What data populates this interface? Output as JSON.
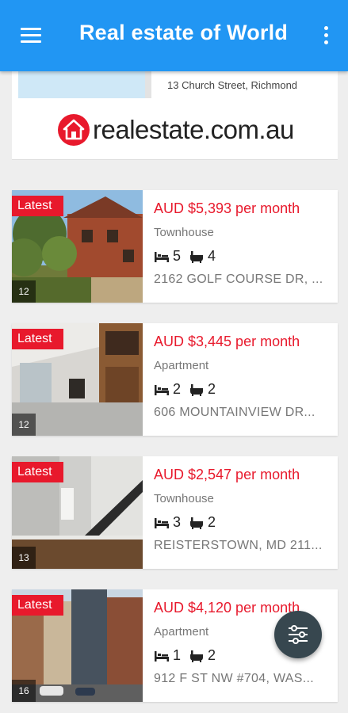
{
  "appbar": {
    "title": "Real estate of World"
  },
  "ad": {
    "address": "13 Church Street, Richmond",
    "logo_text": "realestate.com.au",
    "brand_color": "#e8192c"
  },
  "listings": [
    {
      "badge": "Latest",
      "photo_count": "12",
      "price": "AUD $5,393 per month",
      "type": "Townhouse",
      "beds": "5",
      "baths": "4",
      "address": "2162 GOLF COURSE DR, ..."
    },
    {
      "badge": "Latest",
      "photo_count": "12",
      "price": "AUD $3,445 per month",
      "type": "Apartment",
      "beds": "2",
      "baths": "2",
      "address": "606 MOUNTAINVIEW DR..."
    },
    {
      "badge": "Latest",
      "photo_count": "13",
      "price": "AUD $2,547 per month",
      "type": "Townhouse",
      "beds": "3",
      "baths": "2",
      "address": "REISTERSTOWN, MD 211..."
    },
    {
      "badge": "Latest",
      "photo_count": "16",
      "price": "AUD $4,120 per month",
      "type": "Apartment",
      "beds": "1",
      "baths": "2",
      "address": "912 F ST NW #704, WAS..."
    }
  ],
  "icons": {
    "menu": "hamburger-menu-icon",
    "more": "more-vert-icon",
    "bed": "bed-icon",
    "bath": "bathtub-icon",
    "filter": "filter-sliders-icon"
  },
  "colors": {
    "primary": "#2196f3",
    "accent": "#e8192c",
    "fab": "#37474f"
  }
}
